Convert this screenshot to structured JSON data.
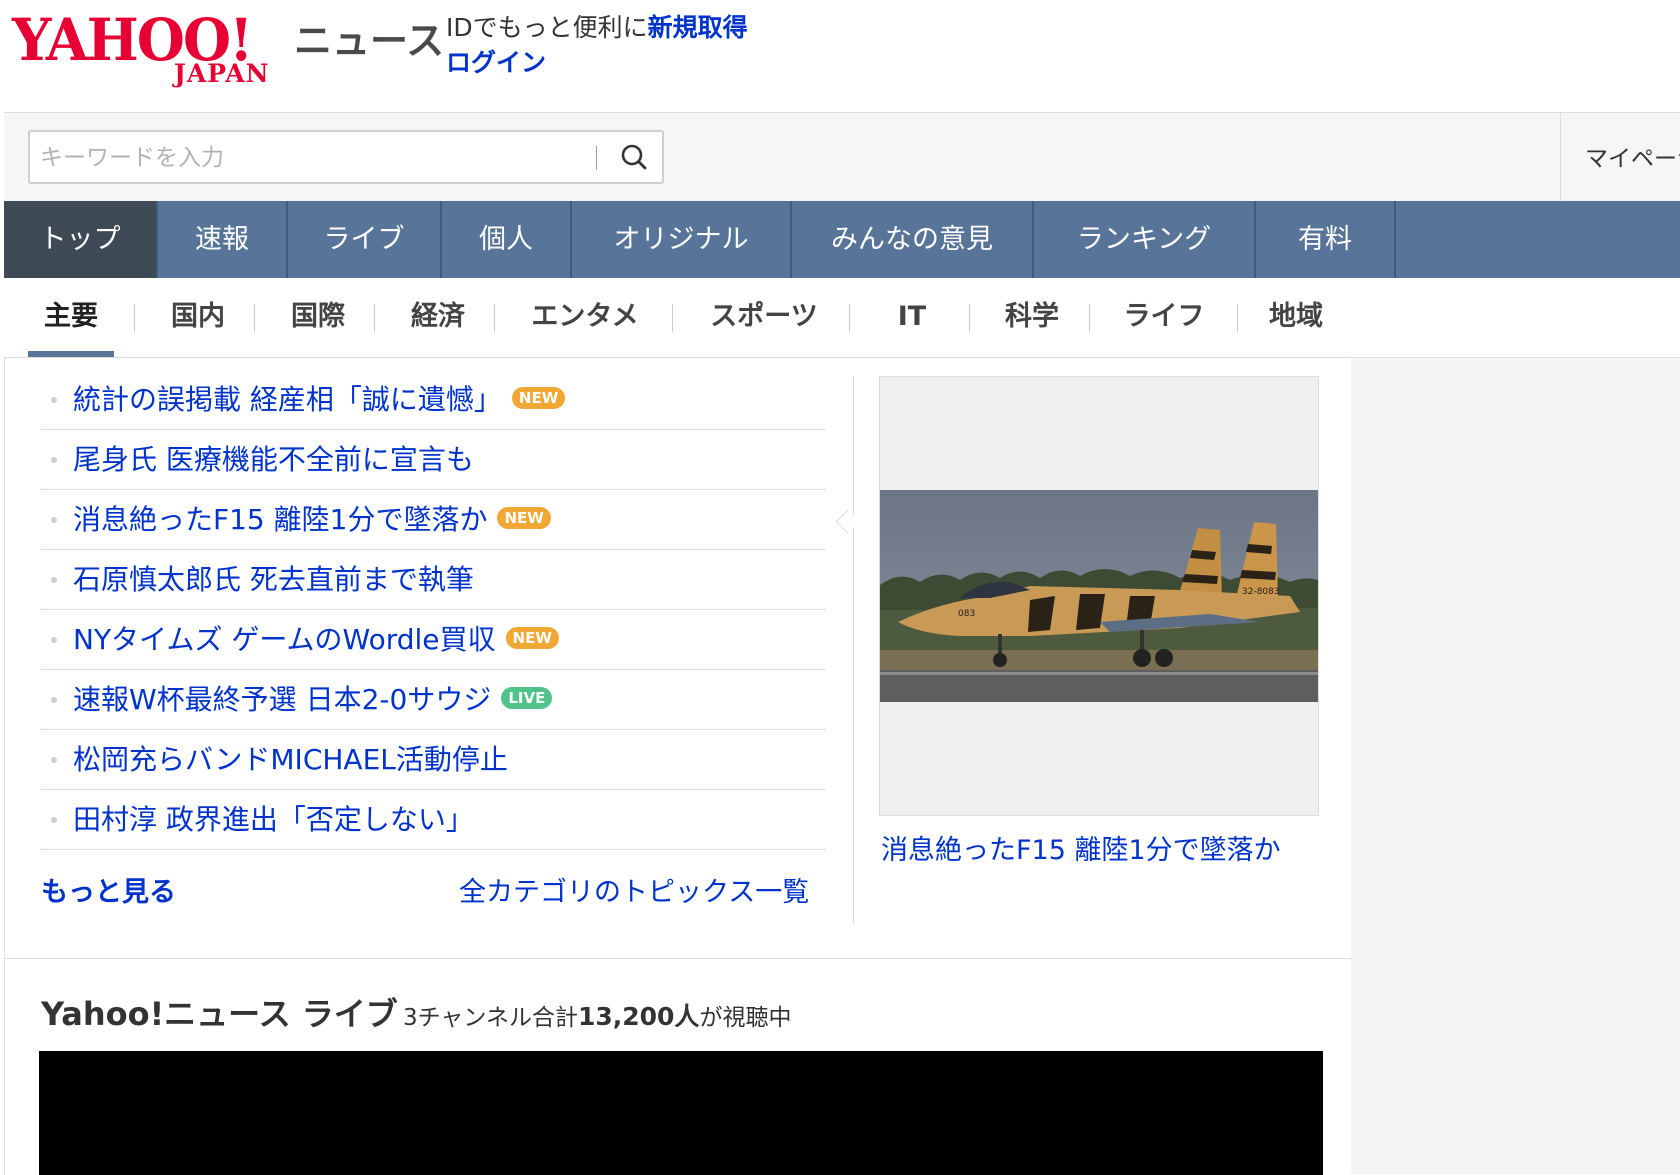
{
  "header": {
    "logo_main": "YAHOO!",
    "logo_sub": "JAPAN",
    "service_name": "ニュース",
    "account_promo": "IDでもっと便利に",
    "signup": "新規取得",
    "login": "ログイン"
  },
  "search": {
    "placeholder": "キーワードを入力",
    "value": "",
    "button_icon": "search-icon"
  },
  "mypage": {
    "label": "マイページ"
  },
  "global_nav": [
    {
      "label": "トップ",
      "active": true
    },
    {
      "label": "速報"
    },
    {
      "label": "ライブ"
    },
    {
      "label": "個人"
    },
    {
      "label": "オリジナル"
    },
    {
      "label": "みんなの意見"
    },
    {
      "label": "ランキング"
    },
    {
      "label": "有料"
    }
  ],
  "category_nav": [
    {
      "label": "主要",
      "active": true
    },
    {
      "label": "国内"
    },
    {
      "label": "国際"
    },
    {
      "label": "経済"
    },
    {
      "label": "エンタメ"
    },
    {
      "label": "スポーツ"
    },
    {
      "label": "IT"
    },
    {
      "label": "科学"
    },
    {
      "label": "ライフ"
    },
    {
      "label": "地域"
    }
  ],
  "topics": {
    "items": [
      {
        "title": "統計の誤掲載 経産相「誠に遺憾」",
        "badge": "NEW"
      },
      {
        "title": "尾身氏 医療機能不全前に宣言も",
        "badge": ""
      },
      {
        "title": "消息絶ったF15 離陸1分で墜落か",
        "badge": "NEW"
      },
      {
        "title": "石原慎太郎氏 死去直前まで執筆",
        "badge": ""
      },
      {
        "title": "NYタイムズ ゲームのWordle買収",
        "badge": "NEW"
      },
      {
        "title": "速報W杯最終予選 日本2-0サウジ",
        "badge": "LIVE"
      },
      {
        "title": "松岡充らバンドMICHAEL活動停止",
        "badge": ""
      },
      {
        "title": "田村淳 政界進出「否定しない」",
        "badge": ""
      }
    ],
    "more": "もっと見る",
    "all_topics": "全カテゴリのトピックス一覧",
    "pickup_caption": "消息絶ったF15 離陸1分で墜落か",
    "pickup_aircraft_marks": {
      "nose": "083",
      "tail": "32-8083"
    }
  },
  "live": {
    "title": "Yahoo!ニュース ライブ",
    "viewers_prefix": "3チャンネル合計",
    "viewers_count": "13,200人",
    "viewers_suffix": "が視聴中"
  },
  "colors": {
    "brand_red": "#e60033",
    "link_blue": "#0033cc",
    "nav_blue": "#587599",
    "nav_active": "#3f4a57",
    "badge_new": "#f0a733",
    "badge_live": "#4fc38a"
  }
}
